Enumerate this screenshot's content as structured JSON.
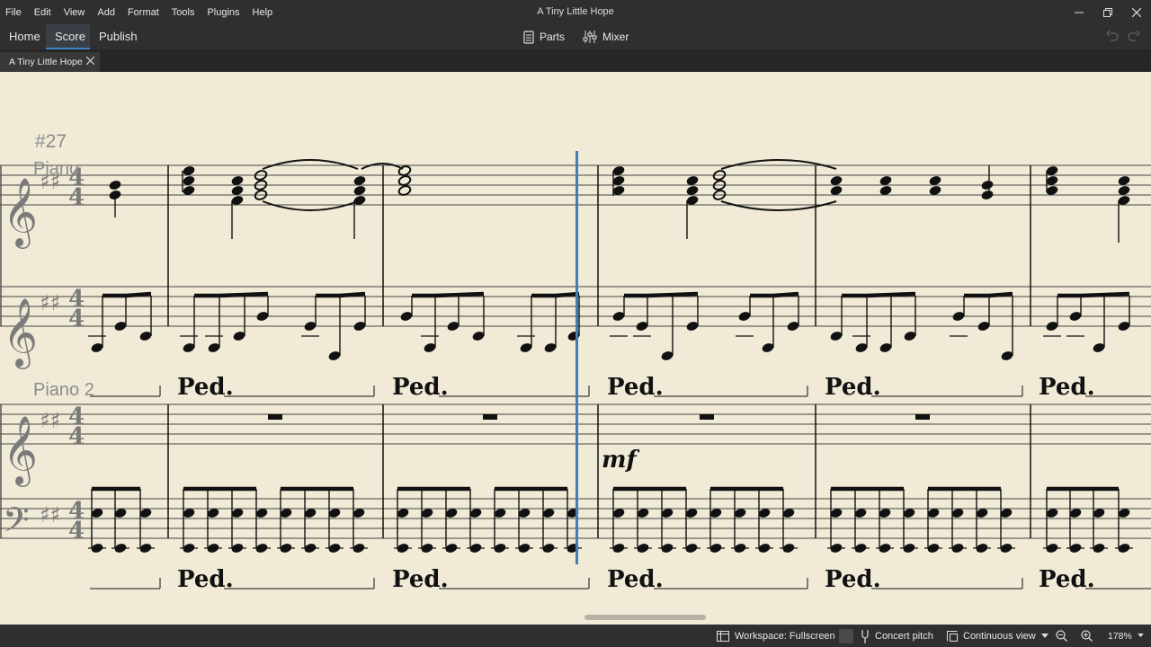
{
  "menu": {
    "items": [
      "File",
      "Edit",
      "View",
      "Add",
      "Format",
      "Tools",
      "Plugins",
      "Help"
    ]
  },
  "window": {
    "title": "A Tiny Little Hope"
  },
  "modes": {
    "home": "Home",
    "score": "Score",
    "publish": "Publish"
  },
  "tools": {
    "parts": "Parts",
    "mixer": "Mixer"
  },
  "document_tab": {
    "title": "A Tiny Little Hope"
  },
  "score": {
    "rehearsal_mark": "#27",
    "instrument_1": "Piano",
    "instrument_2": "Piano 2",
    "dynamic": "mf",
    "pedal_mark": "Ped.",
    "key_signature": "D major",
    "time_signature": "4/4"
  },
  "status": {
    "workspace": "Workspace: Fullscreen",
    "concert_pitch": "Concert pitch",
    "view_mode": "Continuous view",
    "zoom": "178%"
  },
  "colors": {
    "accent": "#3a84c6",
    "paper": "#f0ead6",
    "playhead": "#3b7fb5"
  }
}
